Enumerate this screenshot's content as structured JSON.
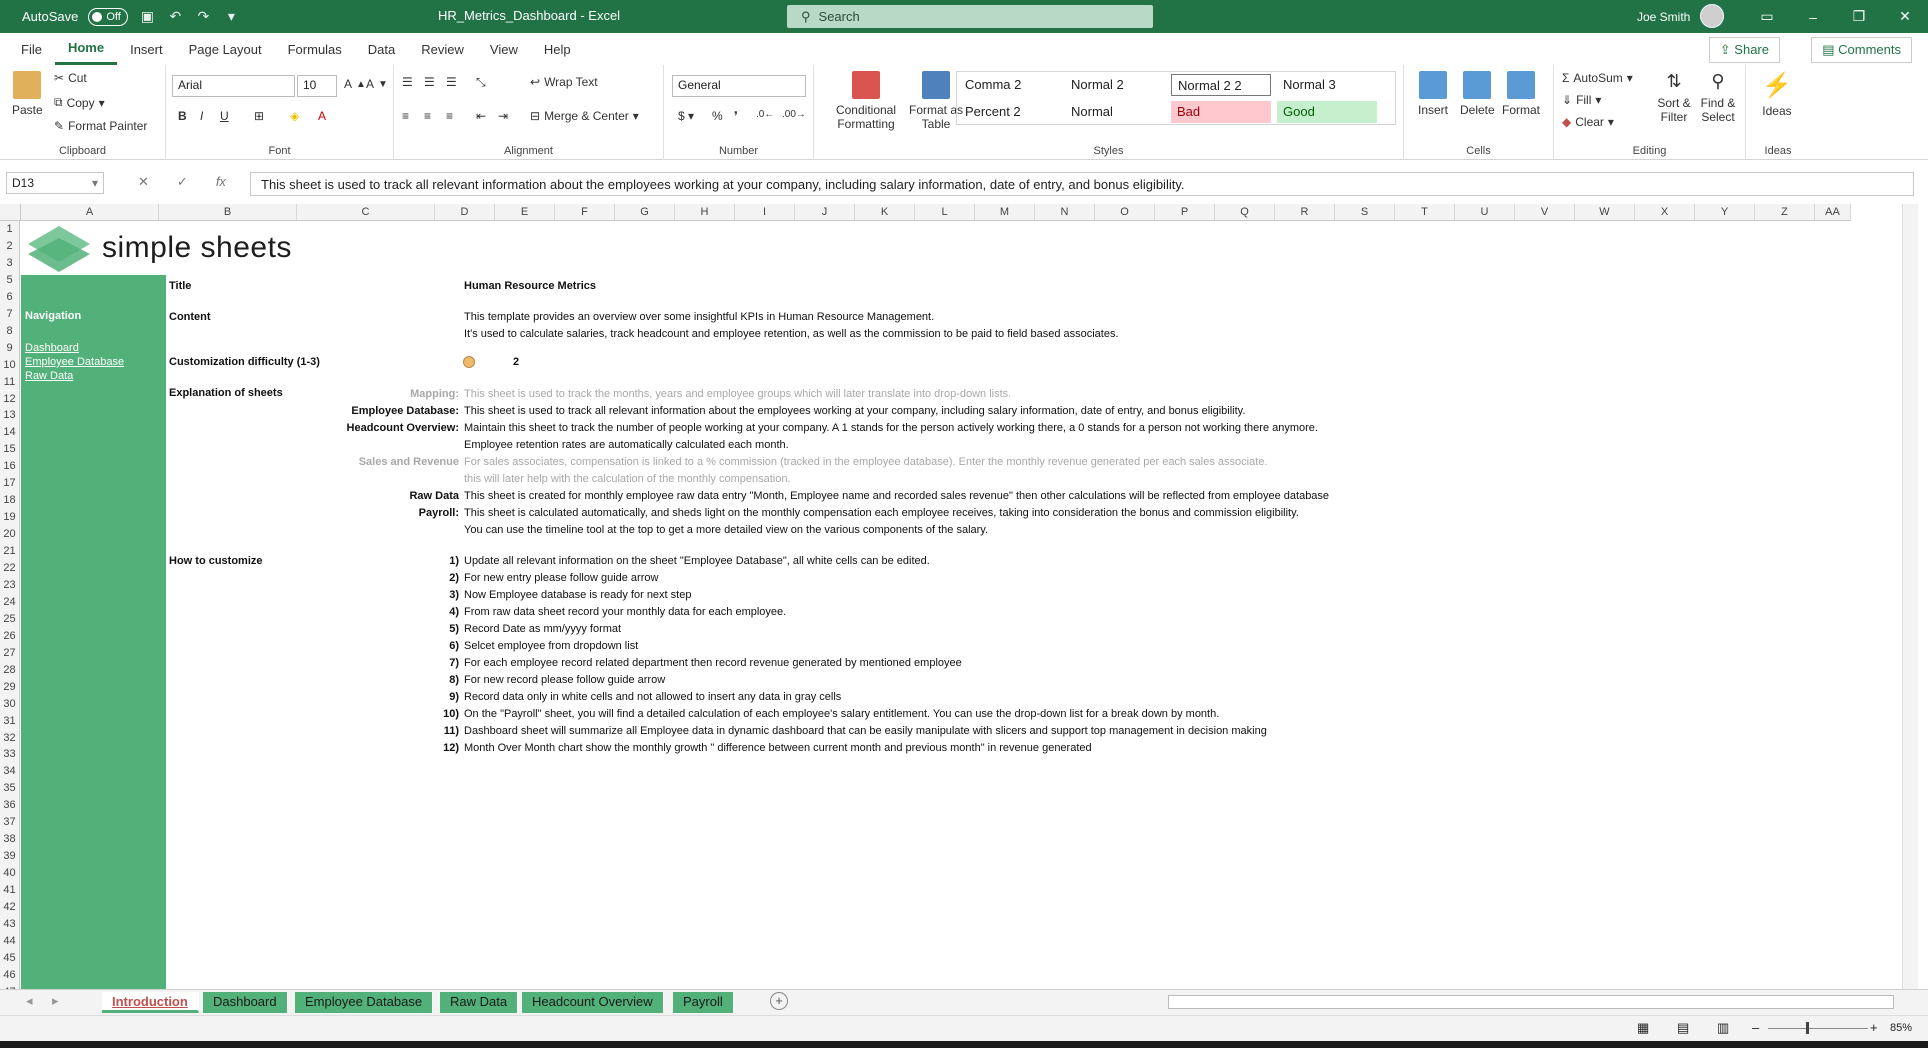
{
  "titlebar": {
    "autosave_label": "AutoSave",
    "autosave_state": "Off",
    "doc_title": "HR_Metrics_Dashboard  -  Excel",
    "search_placeholder": "Search",
    "user_name": "Joe Smith"
  },
  "menu": {
    "items": [
      "File",
      "Home",
      "Insert",
      "Page Layout",
      "Formulas",
      "Data",
      "Review",
      "View",
      "Help"
    ],
    "active": "Home",
    "share": "Share",
    "comments": "Comments"
  },
  "ribbon": {
    "clipboard": {
      "paste": "Paste",
      "cut": "Cut",
      "copy": "Copy",
      "format_painter": "Format Painter",
      "label": "Clipboard"
    },
    "font": {
      "name": "Arial",
      "size": "10",
      "label": "Font"
    },
    "alignment": {
      "wrap": "Wrap Text",
      "merge": "Merge & Center",
      "label": "Alignment"
    },
    "number": {
      "format": "General",
      "label": "Number"
    },
    "styles": {
      "conditional": "Conditional Formatting",
      "format_table": "Format as Table",
      "cells": [
        {
          "name": "Comma 2",
          "bg": "#ffffff",
          "fg": "#222222"
        },
        {
          "name": "Normal 2",
          "bg": "#ffffff",
          "fg": "#222222"
        },
        {
          "name": "Normal 2 2",
          "bg": "#ffffff",
          "fg": "#222222"
        },
        {
          "name": "Normal 3",
          "bg": "#ffffff",
          "fg": "#222222"
        },
        {
          "name": "Percent 2",
          "bg": "#ffffff",
          "fg": "#222222"
        },
        {
          "name": "Normal",
          "bg": "#ffffff",
          "fg": "#222222"
        },
        {
          "name": "Bad",
          "bg": "#ffc7ce",
          "fg": "#9c0006"
        },
        {
          "name": "Good",
          "bg": "#c6efce",
          "fg": "#006100"
        }
      ],
      "label": "Styles"
    },
    "cells_grp": {
      "insert": "Insert",
      "delete": "Delete",
      "format": "Format",
      "label": "Cells"
    },
    "editing": {
      "autosum": "AutoSum",
      "fill": "Fill",
      "clear": "Clear",
      "sort": "Sort & Filter",
      "find": "Find & Select",
      "label": "Editing"
    },
    "ideas": {
      "btn": "Ideas",
      "label": "Ideas"
    }
  },
  "formula_bar": {
    "name_box": "D13",
    "content": "This sheet is used to track all relevant information about the employees working at your company, including salary information, date of entry, and bonus eligibility."
  },
  "columns": [
    "A",
    "B",
    "C",
    "D",
    "E",
    "F",
    "G",
    "H",
    "I",
    "J",
    "K",
    "L",
    "M",
    "N",
    "O",
    "P",
    "Q",
    "R",
    "S",
    "T",
    "U",
    "V",
    "W",
    "X",
    "Y",
    "Z",
    "AA"
  ],
  "rows": [
    "1",
    "2",
    "3",
    "5",
    "6",
    "7",
    "8",
    "9",
    "10",
    "11",
    "12",
    "13",
    "14",
    "15",
    "16",
    "17",
    "18",
    "19",
    "20",
    "21",
    "22",
    "23",
    "24",
    "25",
    "26",
    "27",
    "28",
    "29",
    "30",
    "31",
    "32",
    "33",
    "34",
    "35",
    "36",
    "37",
    "38",
    "39",
    "40",
    "41",
    "42",
    "43",
    "44",
    "45",
    "46",
    "47"
  ],
  "sheet": {
    "logo_text": "simple sheets",
    "nav_heading": "Navigation",
    "nav_links": [
      "Dashboard",
      "Employee Database",
      "Raw Data"
    ],
    "title_label": "Title",
    "title_value": "Human Resource Metrics",
    "content_label": "Content",
    "content_lines": [
      "This template provides an overview over some insightful KPIs in Human Resource Management.",
      "It's used to calculate salaries, track headcount and employee retention, as well as the commission to be paid to field based associates."
    ],
    "difficulty_label": "Customization difficulty (1-3)",
    "difficulty_value": "2",
    "explanation_label": "Explanation of sheets",
    "explanations": [
      {
        "name": "Mapping:",
        "text": "This sheet is used to track the months, years and employee groups which will later translate into drop-down lists.",
        "grey": true
      },
      {
        "name": "Employee Database:",
        "text": "This sheet is used to track all relevant information about the employees working at your company, including salary information, date of entry, and bonus eligibility.",
        "grey": false
      },
      {
        "name": "Headcount Overview:",
        "text": "Maintain this sheet to track the number of people working at your company. A 1 stands for the person actively working there, a 0 stands for a person not working there anymore.",
        "grey": false
      },
      {
        "name": "",
        "text": "Employee retention rates are automatically calculated each month.",
        "grey": false
      },
      {
        "name": "Sales and Revenue",
        "text": "For sales associates, compensation is linked to a % commission (tracked in the employee database). Enter the monthly revenue generated per each sales associate.",
        "grey": true
      },
      {
        "name": "",
        "text": "this will later help with the calculation of the monthly compensation.",
        "grey": true
      },
      {
        "name": "Raw Data",
        "text": "This sheet is created for monthly employee raw data entry \"Month, Employee name and recorded sales revenue\" then other calculations will be reflected from employee database",
        "grey": false
      },
      {
        "name": "Payroll:",
        "text": "This sheet is calculated automatically, and sheds light on the monthly compensation each employee receives, taking into consideration the bonus and commission eligibility.",
        "grey": false
      },
      {
        "name": "",
        "text": "You can use the timeline tool at the top to get a more detailed view on the various components of the salary.",
        "grey": false
      }
    ],
    "customize_label": "How to customize",
    "steps": [
      {
        "n": "1)",
        "t": "Update all relevant information on the sheet \"Employee Database\", all white cells can be edited."
      },
      {
        "n": "2)",
        "t": "For new entry please follow guide arrow"
      },
      {
        "n": "3)",
        "t": "Now Employee database is ready for next step"
      },
      {
        "n": "4)",
        "t": "From raw data sheet record your monthly data for each employee."
      },
      {
        "n": "5)",
        "t": "Record Date as mm/yyyy format"
      },
      {
        "n": "6)",
        "t": "Selcet employee from dropdown list"
      },
      {
        "n": "7)",
        "t": "For each employee record related department then record revenue generated by mentioned employee"
      },
      {
        "n": "8)",
        "t": "For new record please follow guide arrow"
      },
      {
        "n": "9)",
        "t": "Record data only in white cells and not allowed to insert any data in gray cells"
      },
      {
        "n": "10)",
        "t": "On the \"Payroll\" sheet, you will find a detailed calculation of each employee's salary entitlement. You can use the drop-down list for a break down by month."
      },
      {
        "n": "11)",
        "t": "Dashboard sheet will summarize all Employee data in dynamic dashboard that can be easily manipulate with slicers and support top management in decision making"
      },
      {
        "n": "12)",
        "t": "Month Over Month chart show the monthly growth \" difference between current month and previous month\" in revenue generated"
      }
    ]
  },
  "tabs": [
    "Introduction",
    "Dashboard",
    "Employee Database",
    "Raw Data",
    "Headcount Overview",
    "Payroll"
  ],
  "active_tab": "Introduction",
  "status": {
    "zoom": "85%"
  }
}
